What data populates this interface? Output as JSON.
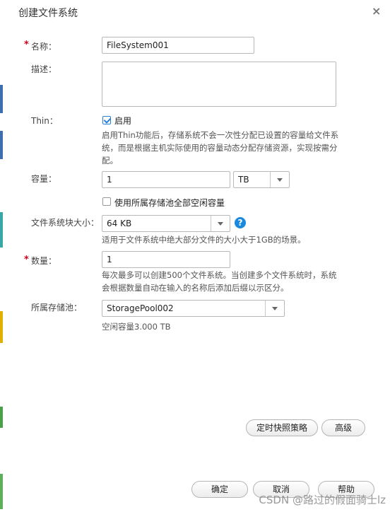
{
  "dialog": {
    "title": "创建文件系统",
    "close_glyph": "×"
  },
  "form": {
    "name": {
      "label": "名称：",
      "required_mark": "*",
      "value": "FileSystem001"
    },
    "description": {
      "label": "描述：",
      "value": ""
    },
    "thin": {
      "label": "Thin：",
      "checkbox_label": "启用",
      "checked": true,
      "help": "启用Thin功能后，存储系统不会一次性分配已设置的容量给文件系统，而是根据主机实际使用的容量动态分配存储资源，实现按需分配。"
    },
    "capacity": {
      "label": "容量：",
      "value": "1",
      "unit": "TB",
      "use_all_label": "使用所属存储池全部空闲容量",
      "use_all_checked": false
    },
    "block_size": {
      "label": "文件系统块大小：",
      "value": "64 KB",
      "help_icon": "?",
      "help": "适用于文件系统中绝大部分文件的大小大于1GB的场景。"
    },
    "quantity": {
      "label": "数量：",
      "required_mark": "*",
      "value": "1",
      "help": "每次最多可以创建500个文件系统。当创建多个文件系统时，系统会根据数量自动在输入的名称后添加后缀以示区分。"
    },
    "pool": {
      "label": "所属存储池：",
      "value": "StoragePool002",
      "free_capacity": "空闲容量3.000 TB"
    }
  },
  "buttons": {
    "snapshot": "定时快照策略",
    "advanced": "高级",
    "ok": "确定",
    "cancel": "取消",
    "help": "帮助"
  },
  "watermark": "CSDN @路过的假面骑士lz",
  "colors": {
    "accent": "#1a8ae0",
    "required": "#d0021b"
  }
}
